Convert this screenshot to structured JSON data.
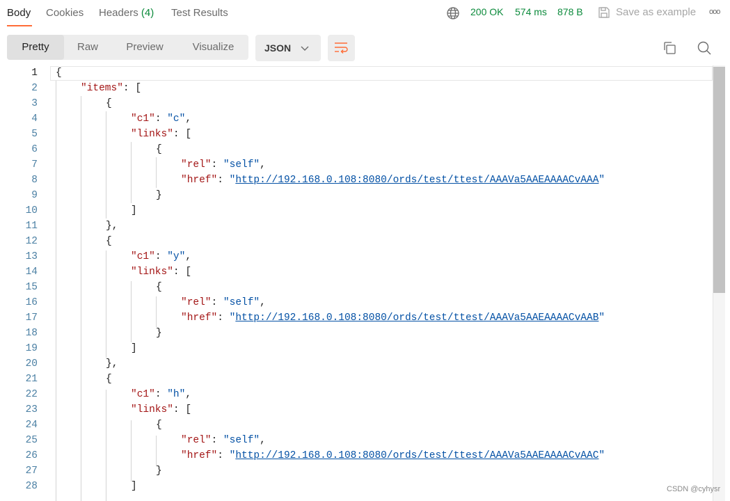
{
  "tabs": [
    {
      "label": "Body"
    },
    {
      "label": "Cookies"
    },
    {
      "label": "Headers",
      "count": "(4)"
    },
    {
      "label": "Test Results"
    }
  ],
  "status": {
    "code": "200 OK",
    "time": "574 ms",
    "size": "878 B",
    "save_label": "Save as example",
    "more_label": "ooo"
  },
  "view_modes": [
    "Pretty",
    "Raw",
    "Preview",
    "Visualize"
  ],
  "format_select": {
    "selected": "JSON"
  },
  "colors": {
    "accent": "#ff6c37",
    "success": "#0b8a3b",
    "key": "#a31515",
    "string": "#0451a5"
  },
  "icons": [
    "globe-icon",
    "save-icon",
    "more-icon",
    "chevron-down-icon",
    "wrap-lines-icon",
    "copy-icon",
    "search-icon"
  ],
  "editor": {
    "line_numbers": [
      "1",
      "2",
      "3",
      "4",
      "5",
      "6",
      "7",
      "8",
      "9",
      "10",
      "11",
      "12",
      "13",
      "14",
      "15",
      "16",
      "17",
      "18",
      "19",
      "20",
      "21",
      "22",
      "23",
      "24",
      "25",
      "26",
      "27",
      "28"
    ],
    "keys": {
      "items": "\"items\"",
      "c1": "\"c1\"",
      "links": "\"links\"",
      "rel": "\"rel\"",
      "href": "\"href\""
    },
    "values": {
      "c1_1": "\"c\"",
      "c1_2": "\"y\"",
      "c1_3": "\"h\"",
      "rel": "\"self\""
    },
    "urls": [
      "http://192.168.0.108:8080/ords/test/ttest/AAAVa5AAEAAAACvAAA",
      "http://192.168.0.108:8080/ords/test/ttest/AAAVa5AAEAAAACvAAB",
      "http://192.168.0.108:8080/ords/test/ttest/AAAVa5AAEAAAACvAAC"
    ]
  },
  "watermark": "CSDN @cyhysr"
}
